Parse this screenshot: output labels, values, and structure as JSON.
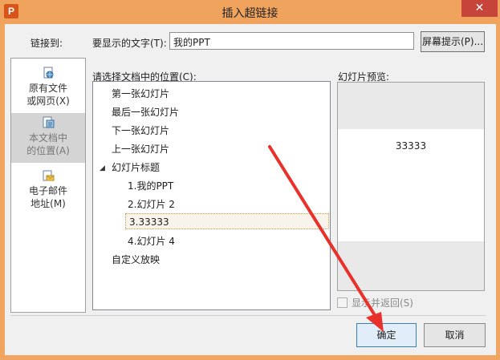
{
  "window": {
    "title": "插入超链接",
    "app_icon": "P",
    "close_glyph": "✕"
  },
  "header": {
    "link_to_label": "链接到:",
    "display_text_label": "要显示的文字(T):",
    "display_text_value": "我的PPT",
    "screen_tip_button": "屏幕提示(P)..."
  },
  "sidebar": {
    "items": [
      {
        "line1": "原有文件",
        "line2": "或网页(X)",
        "icon": "globe-file-icon",
        "selected": false
      },
      {
        "line1": "本文档中",
        "line2": "的位置(A)",
        "icon": "document-place-icon",
        "selected": true
      },
      {
        "line1": "电子邮件",
        "line2": "地址(M)",
        "icon": "email-icon",
        "selected": false
      }
    ]
  },
  "location": {
    "label": "请选择文档中的位置(C):",
    "items": [
      {
        "text": "第一张幻灯片"
      },
      {
        "text": "最后一张幻灯片"
      },
      {
        "text": "下一张幻灯片"
      },
      {
        "text": "上一张幻灯片"
      },
      {
        "text": "幻灯片标题",
        "expanded": true
      },
      {
        "text": "1.我的PPT"
      },
      {
        "text": "2.幻灯片 2"
      },
      {
        "text": "3.33333",
        "selected": true
      },
      {
        "text": "4.幻灯片 4"
      },
      {
        "text": "自定义放映"
      }
    ]
  },
  "preview": {
    "label": "幻灯片预览:",
    "slide_text": "33333",
    "show_and_return": "显示并返回(S)"
  },
  "buttons": {
    "ok": "确定",
    "cancel": "取消"
  },
  "colors": {
    "titlebar": "#f0a35c",
    "close": "#c7443a",
    "annotation_arrow": "#e8312b"
  }
}
